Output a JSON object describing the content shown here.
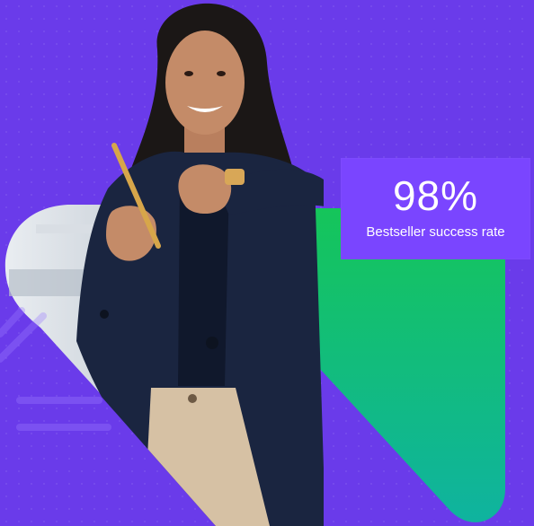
{
  "colors": {
    "background": "#6a3bea",
    "card": "#7a45ff",
    "green_top": "#15c55a",
    "green_bottom": "#0fb39f",
    "jacket": "#1a2540",
    "pants": "#d6c1a4",
    "skin": "#c48b68",
    "pen": "#d7a64a"
  },
  "icons": {
    "person": "woman-pointing-photo",
    "pen": "gold-pen"
  },
  "stat": {
    "value": "98%",
    "label": "Bestseller success rate"
  }
}
